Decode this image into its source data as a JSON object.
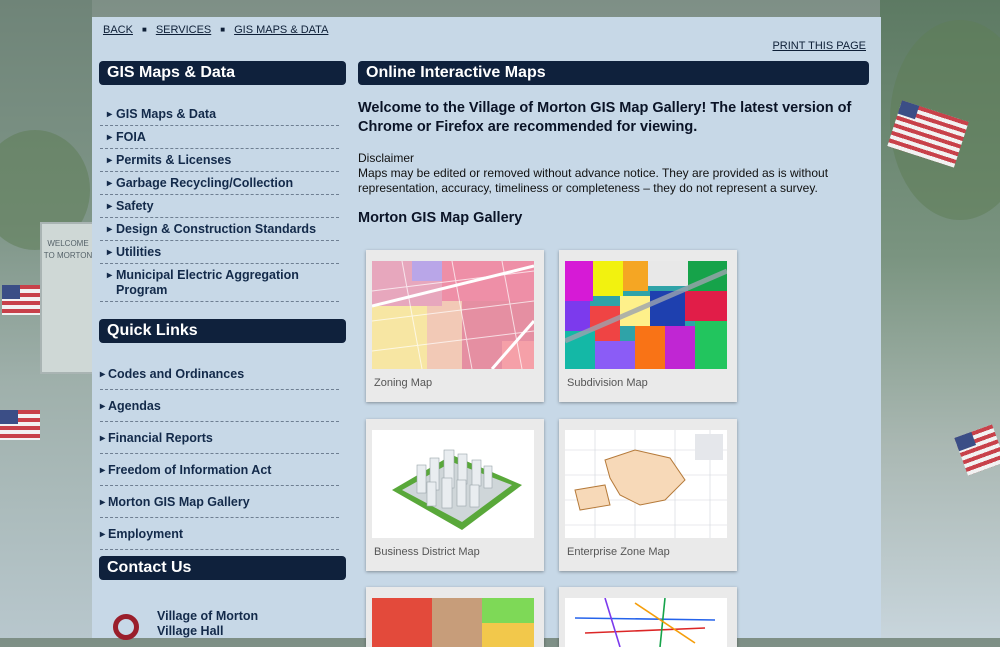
{
  "breadcrumbs": [
    "BACK",
    "SERVICES",
    "GIS MAPS & DATA"
  ],
  "print_link": "PRINT THIS PAGE",
  "sidebar": {
    "section_title": "GIS Maps & Data",
    "items": [
      "GIS Maps & Data",
      "FOIA",
      "Permits & Licenses",
      "Garbage Recycling/Collection",
      "Safety",
      "Design & Construction Standards",
      "Utilities",
      "Municipal Electric Aggregation Program"
    ],
    "quick_links_title": "Quick Links",
    "quick_links": [
      "Codes and Ordinances",
      "Agendas",
      "Financial Reports",
      "Freedom of Information Act",
      "Morton GIS Map Gallery",
      "Employment"
    ],
    "contact_title": "Contact Us",
    "contact_name": "Village of Morton",
    "contact_place": "Village Hall"
  },
  "main": {
    "title": "Online Interactive Maps",
    "welcome": "Welcome to the Village of Morton GIS Map Gallery! The latest version of Chrome or Firefox are recommended for viewing.",
    "disclaimer_label": "Disclaimer",
    "disclaimer_text": "Maps may be edited or removed without advance notice. They are provided as is without representation, accuracy, timeliness or completeness – they do not represent a survey.",
    "gallery_heading": "Morton GIS Map Gallery",
    "maps": [
      {
        "caption": "Zoning Map"
      },
      {
        "caption": "Subdivision Map"
      },
      {
        "caption": "Business District Map"
      },
      {
        "caption": "Enterprise Zone Map"
      }
    ]
  },
  "background": {
    "sign_text": "WELCOME TO MORTON"
  },
  "colors": {
    "nav_bar": "#0f213c",
    "page_bg": "#c7d8e7",
    "contact_icon": "#9a1e2b"
  }
}
